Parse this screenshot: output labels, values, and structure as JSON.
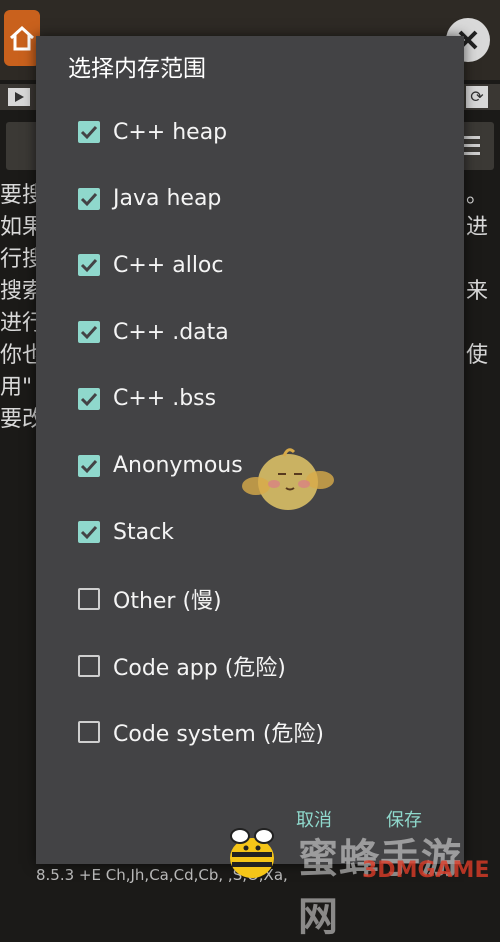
{
  "background": {
    "left_text_lines": [
      "要搜",
      "如果",
      "行搜",
      "搜索",
      "进行",
      "你也",
      "用\"",
      "要改"
    ],
    "right_text_lines": [
      "。",
      "进",
      "",
      "来",
      "",
      "使",
      "",
      ""
    ],
    "status_line": "8.5.3  +E Ch,Jh,Ca,Cd,Cb,  ,S,O,Xa,"
  },
  "dialog": {
    "title": "选择内存范围",
    "options": [
      {
        "label": "C++ heap",
        "checked": true
      },
      {
        "label": "Java heap",
        "checked": true
      },
      {
        "label": "C++ alloc",
        "checked": true
      },
      {
        "label": "C++ .data",
        "checked": true
      },
      {
        "label": "C++ .bss",
        "checked": true
      },
      {
        "label": "Anonymous",
        "checked": true
      },
      {
        "label": "Stack",
        "checked": true
      },
      {
        "label": "Other (慢)",
        "checked": false
      },
      {
        "label": "Code app (危险)",
        "checked": false
      },
      {
        "label": "Code system (危险)",
        "checked": false
      }
    ],
    "cancel_label": "取消",
    "save_label": "保存"
  },
  "watermark": {
    "text": "蜜蜂手游网",
    "sub": "3DMGAME"
  },
  "colors": {
    "accent": "#8fd8cc",
    "dialog_bg": "#434345",
    "home_button": "#c9611d"
  }
}
